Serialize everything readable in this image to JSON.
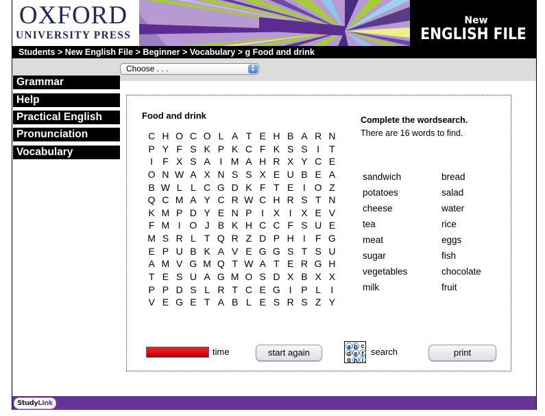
{
  "header": {
    "logo_line1": "OXFORD",
    "logo_line2": "UNIVERSITY PRESS",
    "brand_small": "New",
    "brand_large": "ENGLISH FILE"
  },
  "breadcrumb": [
    "Students",
    "New English File",
    "Beginner",
    "Vocabulary",
    "g Food and drink"
  ],
  "breadcrumb_separator": " > ",
  "select": {
    "value": "Choose . . ."
  },
  "sidebar": {
    "items": [
      {
        "label": "Grammar"
      },
      {
        "label": "Help"
      },
      {
        "label": "Practical English"
      },
      {
        "label": "Pronunciation"
      },
      {
        "label": "Vocabulary"
      }
    ]
  },
  "exercise": {
    "title": "Food and drink",
    "instruction": "Complete the wordsearch.",
    "word_count_text": "There are 16 words to find.",
    "grid": [
      "CHOCOLATEHBARN",
      "PYFSKPKCFKSSIT",
      "IFXSAIMAHRXYCE",
      "ONWAXNSSXEUBEA",
      "BWLLCGDKFTEIOZ",
      "QCMAYCRWCHRSTN",
      "KMPDYENPIXIXEV",
      "FMIOJBKHCCFSUE",
      "MSRLTQRZDPHIFG",
      "EPUBKAVEGGSTSU",
      "AMVGMQTWATERGH",
      "TESUAGMOSDXBXX",
      "PPDSLRTCEGIPLI",
      "VEGETABLESRSZY"
    ],
    "words_left": [
      "sandwich",
      "potatoes",
      "cheese",
      "tea",
      "meat",
      "sugar",
      "vegetables",
      "milk"
    ],
    "words_right": [
      "bread",
      "salad",
      "water",
      "rice",
      "eggs",
      "fish",
      "chocolate",
      "fruit"
    ]
  },
  "controls": {
    "time_label": "time",
    "time_remaining_fraction": 1.0,
    "start_again_label": "start again",
    "search_label": "search",
    "search_icon_letters": [
      "a",
      "b",
      "c",
      "d",
      "e",
      "f",
      "g",
      "h",
      "i"
    ],
    "print_label": "print"
  },
  "footer": {
    "studylink_bold": "Study",
    "studylink_color": "Link"
  },
  "colors": {
    "brand_navy": "#1f2a55",
    "footer_purple": "#663399",
    "timebar_red": "#e51010",
    "gray_band": "#dcdcdc"
  }
}
